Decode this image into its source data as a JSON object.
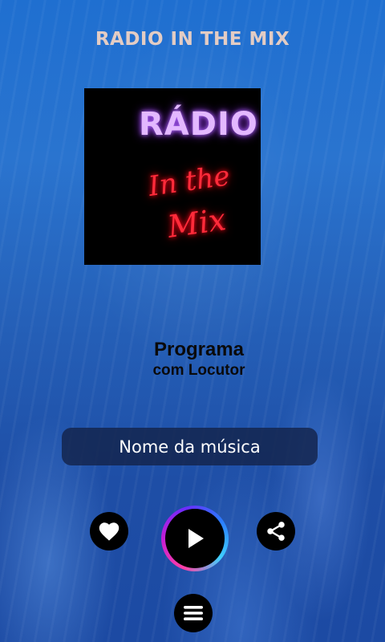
{
  "header": {
    "title": "RADIO IN THE MIX"
  },
  "cover": {
    "line1": "RÁDIO",
    "line2": "In the",
    "line3": "Mix"
  },
  "program": {
    "name": "Programa",
    "host": "com Locutor"
  },
  "now_playing": {
    "song_title": "Nome da música"
  },
  "controls": {
    "like_icon": "heart-icon",
    "play_icon": "play-icon",
    "share_icon": "share-icon",
    "menu_icon": "menu-icon"
  },
  "colors": {
    "title": "#e3ccc4",
    "background": "#2466c2",
    "button": "#000000",
    "song_box": "#14234b",
    "cover_purple": "#e3b8ff",
    "cover_red": "#ff2b3a"
  }
}
